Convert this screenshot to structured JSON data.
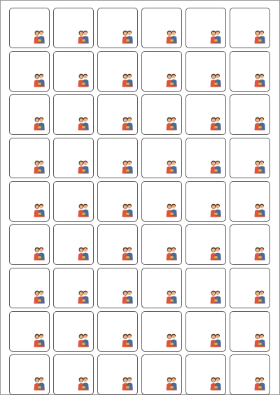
{
  "sheet": {
    "columns": 6,
    "rows": 9,
    "label_art_icon": "couple-portrait-icon",
    "colors": {
      "page": "#ffffff",
      "label_border": "#5a5a5a",
      "sheet_border": "#9a9a9a",
      "art_blue": "#4a6a9a",
      "art_skin": "#e8b48a",
      "art_hair": "#5a3a22",
      "art_accent": "#e0533c",
      "art_yellow": "#e8b030"
    }
  }
}
